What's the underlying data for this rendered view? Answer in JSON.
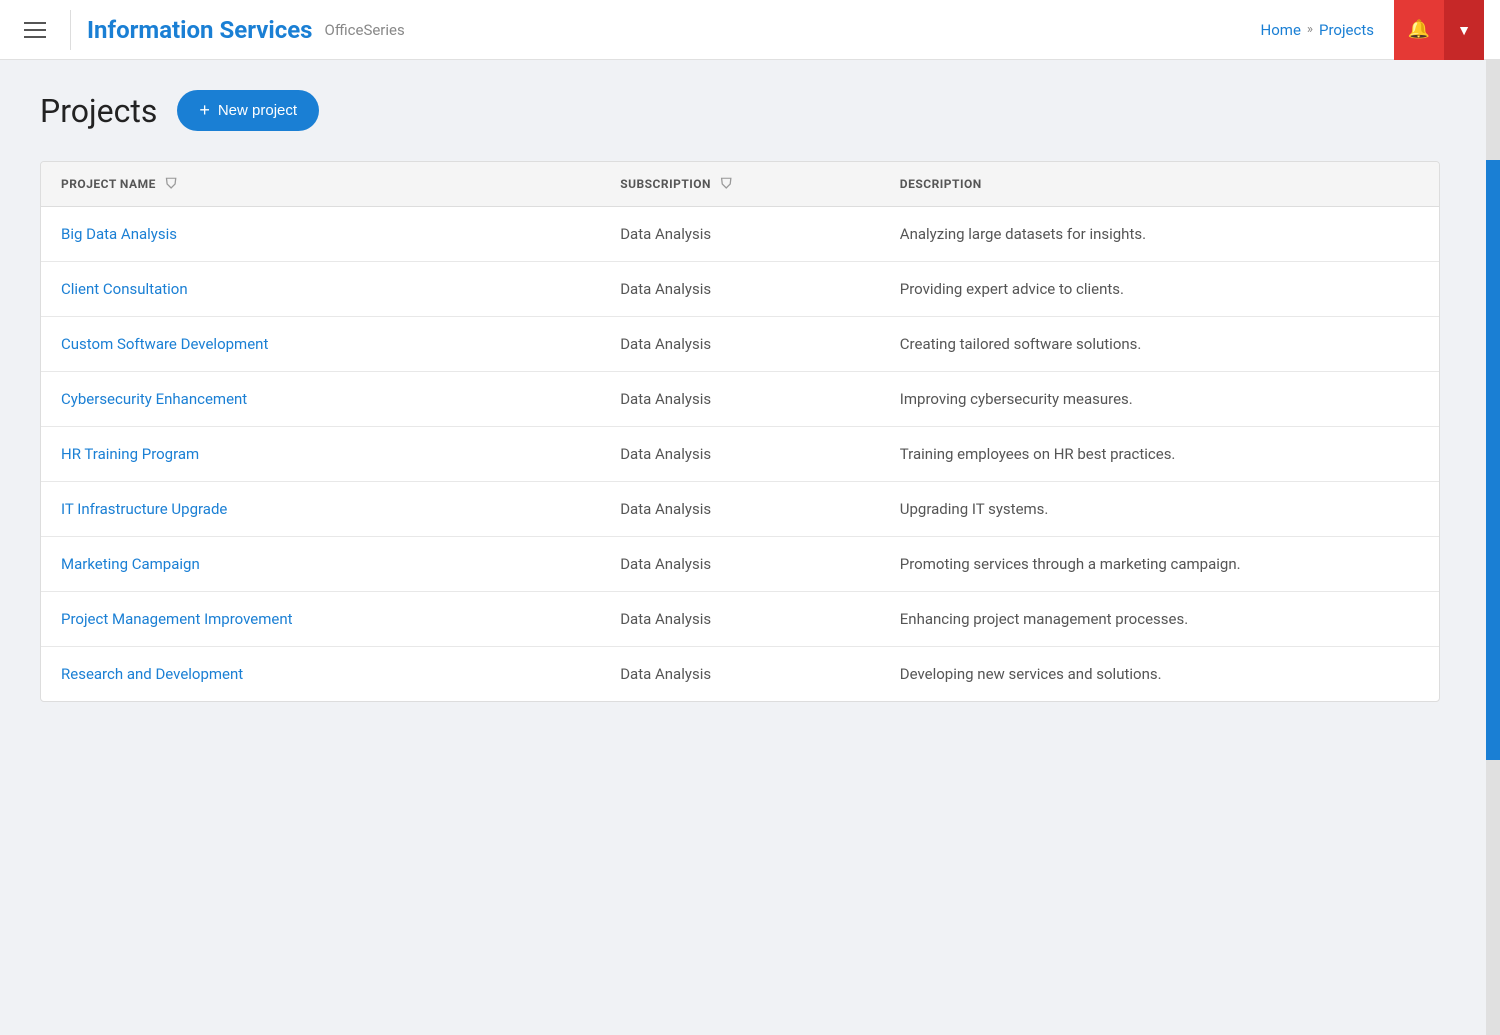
{
  "header": {
    "app_title": "Information Services",
    "office_series": "OfficeSeries",
    "breadcrumb": {
      "home": "Home",
      "separator": "»",
      "current": "Projects"
    }
  },
  "toolbar": {
    "new_project_label": "New project",
    "new_project_plus": "+"
  },
  "page": {
    "title": "Projects"
  },
  "table": {
    "columns": [
      {
        "key": "name",
        "label": "PROJECT NAME",
        "has_filter": true
      },
      {
        "key": "subscription",
        "label": "SUBSCRIPTION",
        "has_filter": true
      },
      {
        "key": "description",
        "label": "DESCRIPTION",
        "has_filter": false
      }
    ],
    "rows": [
      {
        "name": "Big Data Analysis",
        "subscription": "Data Analysis",
        "description": "Analyzing large datasets for insights."
      },
      {
        "name": "Client Consultation",
        "subscription": "Data Analysis",
        "description": "Providing expert advice to clients."
      },
      {
        "name": "Custom Software Development",
        "subscription": "Data Analysis",
        "description": "Creating tailored software solutions."
      },
      {
        "name": "Cybersecurity Enhancement",
        "subscription": "Data Analysis",
        "description": "Improving cybersecurity measures."
      },
      {
        "name": "HR Training Program",
        "subscription": "Data Analysis",
        "description": "Training employees on HR best practices."
      },
      {
        "name": "IT Infrastructure Upgrade",
        "subscription": "Data Analysis",
        "description": "Upgrading IT systems."
      },
      {
        "name": "Marketing Campaign",
        "subscription": "Data Analysis",
        "description": "Promoting services through a marketing campaign."
      },
      {
        "name": "Project Management Improvement",
        "subscription": "Data Analysis",
        "description": "Enhancing project management processes."
      },
      {
        "name": "Research and Development",
        "subscription": "Data Analysis",
        "description": "Developing new services and solutions."
      }
    ]
  },
  "colors": {
    "accent": "#1a7fd4",
    "bell_bg": "#e53935",
    "dropdown_bg": "#c62828"
  }
}
